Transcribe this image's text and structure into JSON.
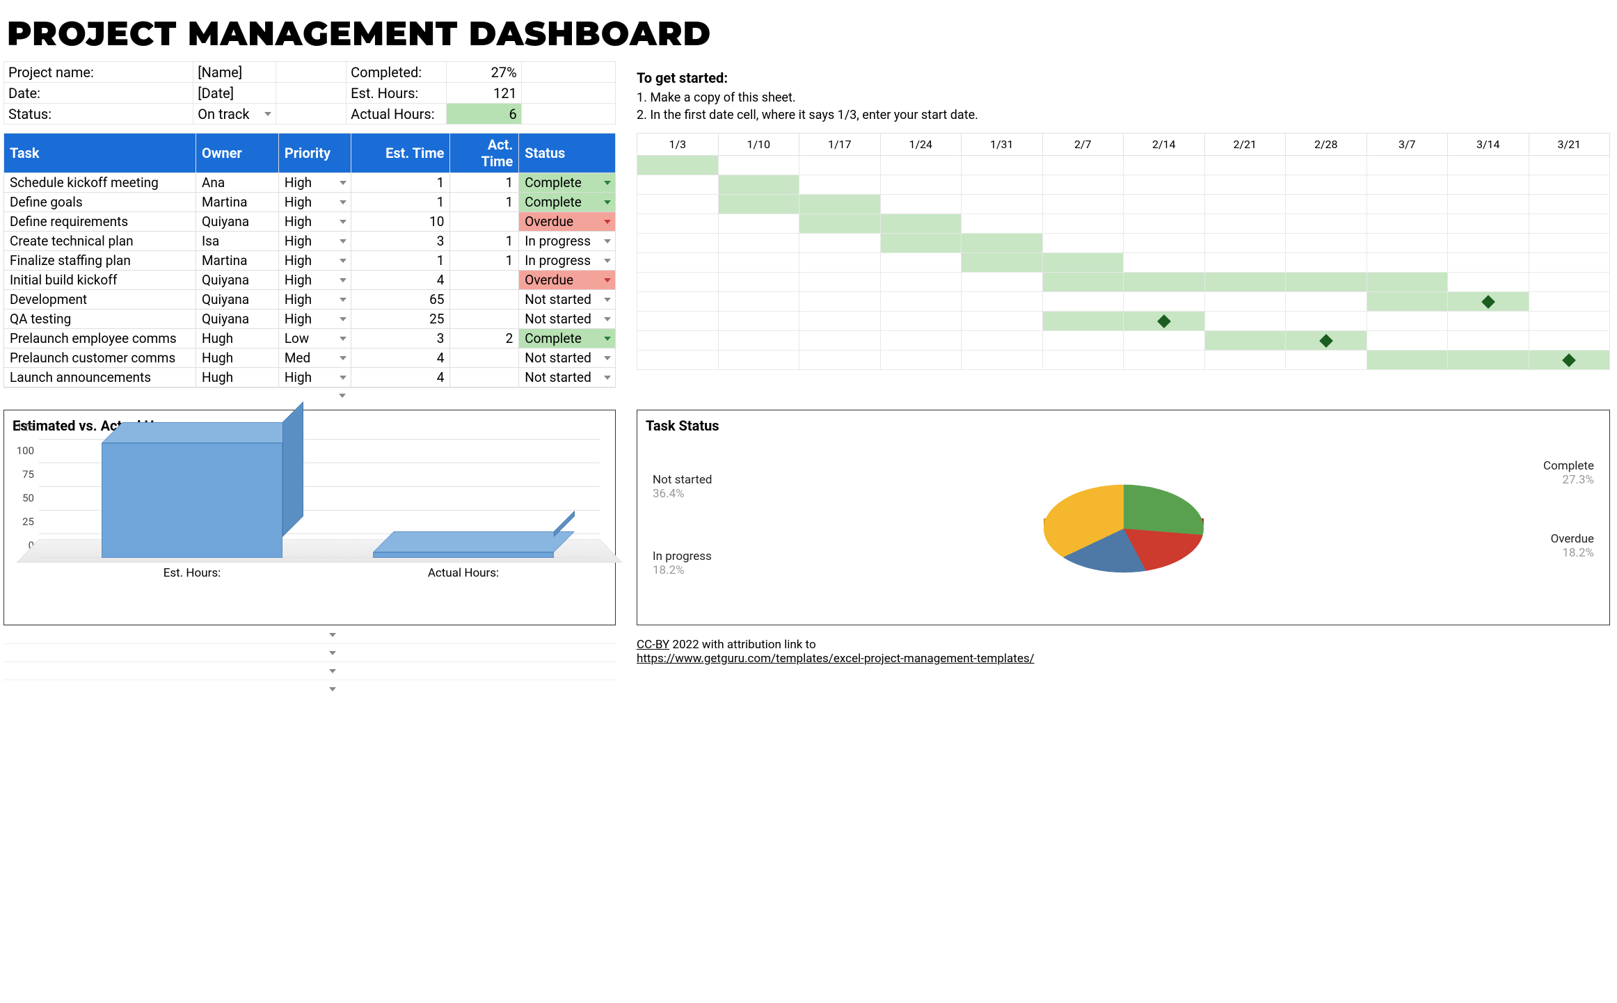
{
  "title": "PROJECT MANAGEMENT DASHBOARD",
  "summary": {
    "rows": [
      {
        "label": "Project name:",
        "value": "[Name]",
        "metric": "Completed:",
        "mvalue": "27%",
        "mgreen": false
      },
      {
        "label": "Date:",
        "value": "[Date]",
        "metric": "Est. Hours:",
        "mvalue": "121",
        "mgreen": false
      },
      {
        "label": "Status:",
        "value": "On track",
        "dropdown": true,
        "metric": "Actual Hours:",
        "mvalue": "6",
        "mgreen": true
      }
    ]
  },
  "get_started": {
    "header": "To get started:",
    "steps": [
      "1. Make a copy of this sheet.",
      "2. In the first date cell, where it says 1/3, enter your start date."
    ]
  },
  "task_headers": [
    "Task",
    "Owner",
    "Priority",
    "Est. Time",
    "Act. Time",
    "Status"
  ],
  "tasks": [
    {
      "task": "Schedule kickoff meeting",
      "owner": "Ana",
      "priority": "High",
      "est": "1",
      "act": "1",
      "status": "Complete",
      "stclass": "chip-complete"
    },
    {
      "task": "Define goals",
      "owner": "Martina",
      "priority": "High",
      "est": "1",
      "act": "1",
      "status": "Complete",
      "stclass": "chip-complete"
    },
    {
      "task": "Define requirements",
      "owner": "Quiyana",
      "priority": "High",
      "est": "10",
      "act": "",
      "status": "Overdue",
      "stclass": "chip-overdue"
    },
    {
      "task": "Create technical plan",
      "owner": "Isa",
      "priority": "High",
      "est": "3",
      "act": "1",
      "status": "In progress",
      "stclass": ""
    },
    {
      "task": "Finalize staffing plan",
      "owner": "Martina",
      "priority": "High",
      "est": "1",
      "act": "1",
      "status": "In progress",
      "stclass": ""
    },
    {
      "task": "Initial build kickoff",
      "owner": "Quiyana",
      "priority": "High",
      "est": "4",
      "act": "",
      "status": "Overdue",
      "stclass": "chip-overdue"
    },
    {
      "task": "Development",
      "owner": "Quiyana",
      "priority": "High",
      "est": "65",
      "act": "",
      "status": "Not started",
      "stclass": ""
    },
    {
      "task": "QA testing",
      "owner": "Quiyana",
      "priority": "High",
      "est": "25",
      "act": "",
      "status": "Not started",
      "stclass": ""
    },
    {
      "task": "Prelaunch employee comms",
      "owner": "Hugh",
      "priority": "Low",
      "est": "3",
      "act": "2",
      "status": "Complete",
      "stclass": "chip-complete"
    },
    {
      "task": "Prelaunch customer comms",
      "owner": "Hugh",
      "priority": "Med",
      "est": "4",
      "act": "",
      "status": "Not started",
      "stclass": ""
    },
    {
      "task": "Launch announcements",
      "owner": "Hugh",
      "priority": "High",
      "est": "4",
      "act": "",
      "status": "Not started",
      "stclass": ""
    }
  ],
  "gantt": {
    "dates": [
      "1/3",
      "1/10",
      "1/17",
      "1/24",
      "1/31",
      "2/7",
      "2/14",
      "2/21",
      "2/28",
      "3/7",
      "3/14",
      "3/21"
    ],
    "rows": [
      {
        "fills": [
          0
        ],
        "diamond": null
      },
      {
        "fills": [
          1
        ],
        "diamond": null
      },
      {
        "fills": [
          1,
          2
        ],
        "diamond": null
      },
      {
        "fills": [
          2,
          3
        ],
        "diamond": null
      },
      {
        "fills": [
          3,
          4
        ],
        "diamond": null
      },
      {
        "fills": [
          4,
          5
        ],
        "diamond": null
      },
      {
        "fills": [
          5,
          6,
          7,
          8,
          9
        ],
        "diamond": null
      },
      {
        "fills": [
          9,
          10
        ],
        "diamond": 10
      },
      {
        "fills": [
          5,
          6
        ],
        "diamond": 6
      },
      {
        "fills": [
          7,
          8
        ],
        "diamond": 8
      },
      {
        "fills": [
          9,
          10,
          11
        ],
        "diamond": 11
      }
    ]
  },
  "chart_data": [
    {
      "type": "bar",
      "title": "Estimated vs. Actual Hours",
      "categories": [
        "Est. Hours:",
        "Actual Hours:"
      ],
      "values": [
        121,
        6
      ],
      "ylim": [
        0,
        125
      ],
      "yticks": [
        0,
        25,
        50,
        75,
        100,
        125
      ]
    },
    {
      "type": "pie",
      "title": "Task Status",
      "slices": [
        {
          "name": "Complete",
          "pct": 27.3,
          "color": "#59a14f"
        },
        {
          "name": "Overdue",
          "pct": 18.2,
          "color": "#cc3b2e"
        },
        {
          "name": "In progress",
          "pct": 18.2,
          "color": "#4e79a7"
        },
        {
          "name": "Not started",
          "pct": 36.4,
          "color": "#f4b72d"
        }
      ]
    }
  ],
  "footer": {
    "line1": "CC-BY 2022 with attribution link to",
    "line1_u": "CC-BY",
    "link": "https://www.getguru.com/templates/excel-project-management-templates/"
  }
}
